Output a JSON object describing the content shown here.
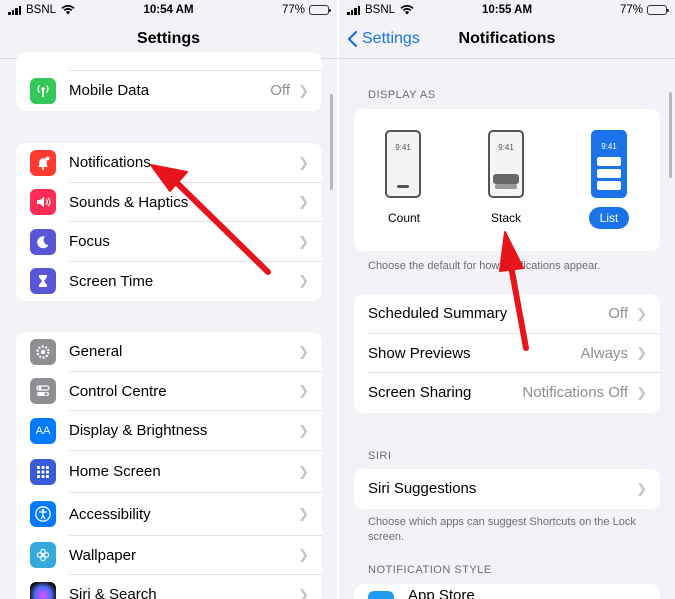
{
  "left": {
    "status": {
      "carrier": "BSNL",
      "time": "10:54 AM",
      "battery": "77%"
    },
    "title": "Settings",
    "group1": [
      {
        "label": "Mobile Data",
        "value": "Off",
        "icon": "antenna-icon",
        "color": "#34c759"
      }
    ],
    "group2": [
      {
        "label": "Notifications",
        "icon": "bell-badge-icon",
        "color": "#ff3b30"
      },
      {
        "label": "Sounds & Haptics",
        "icon": "speaker-icon",
        "color": "#ff2d55"
      },
      {
        "label": "Focus",
        "icon": "moon-icon",
        "color": "#5856d6"
      },
      {
        "label": "Screen Time",
        "icon": "hourglass-icon",
        "color": "#5856d6"
      }
    ],
    "group3": [
      {
        "label": "General",
        "icon": "gear-icon",
        "color": "#8e8e93"
      },
      {
        "label": "Control Centre",
        "icon": "toggles-icon",
        "color": "#8e8e93"
      },
      {
        "label": "Display & Brightness",
        "icon": "text-size-icon",
        "color": "#007aff"
      },
      {
        "label": "Home Screen",
        "icon": "app-grid-icon",
        "color": "#3a5bd9"
      },
      {
        "label": "Accessibility",
        "icon": "accessibility-icon",
        "color": "#007aff"
      },
      {
        "label": "Wallpaper",
        "icon": "flower-icon",
        "color": "#34aadc"
      },
      {
        "label": "Siri & Search",
        "icon": "siri-icon",
        "color": "#222222"
      }
    ]
  },
  "right": {
    "status": {
      "carrier": "BSNL",
      "time": "10:55 AM",
      "battery": "77%"
    },
    "back_label": "Settings",
    "title": "Notifications",
    "display_as_header": "DISPLAY AS",
    "display_options": [
      {
        "label": "Count",
        "time": "9:41"
      },
      {
        "label": "Stack",
        "time": "9:41"
      },
      {
        "label": "List",
        "time": "9:41",
        "selected": true
      }
    ],
    "display_footnote": "Choose the default for how notifications appear.",
    "settings_rows": [
      {
        "label": "Scheduled Summary",
        "value": "Off"
      },
      {
        "label": "Show Previews",
        "value": "Always"
      },
      {
        "label": "Screen Sharing",
        "value": "Notifications Off"
      }
    ],
    "siri_header": "SIRI",
    "siri_row": "Siri Suggestions",
    "siri_footnote": "Choose which apps can suggest Shortcuts on the Lock screen.",
    "style_header": "NOTIFICATION STYLE",
    "style_first_app": "App Store"
  },
  "colors": {
    "accent": "#1a73e8",
    "arrow": "#e8141b"
  }
}
